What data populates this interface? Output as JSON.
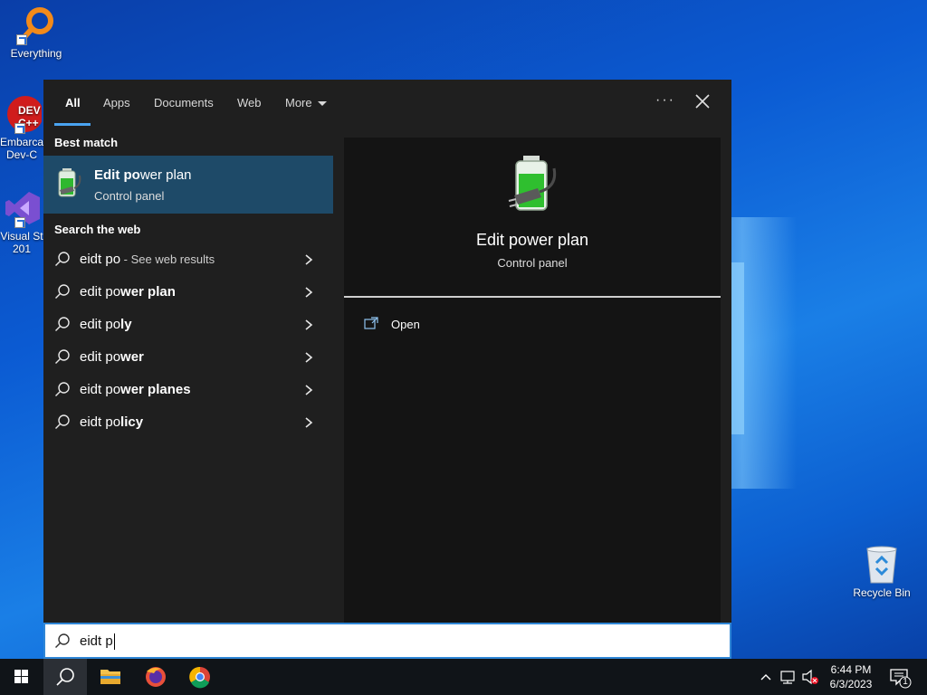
{
  "desktop": {
    "icons": [
      {
        "label": "Everything"
      },
      {
        "label": "Embarca\nDev-C"
      },
      {
        "label": "Visual St\n201"
      },
      {
        "label": "Recycle Bin"
      }
    ]
  },
  "search": {
    "tabs": [
      {
        "label": "All"
      },
      {
        "label": "Apps"
      },
      {
        "label": "Documents"
      },
      {
        "label": "Web"
      },
      {
        "label": "More"
      }
    ],
    "more_options_label": "···",
    "best_match_header": "Best match",
    "best_match": {
      "title_bold": "Edit po",
      "title_rest": "wer plan",
      "subtitle": "Control panel",
      "icon": "battery-power-icon"
    },
    "web_header": "Search the web",
    "suggestions": [
      {
        "normal": "eidt po",
        "bold": "",
        "suffix": " - See web results"
      },
      {
        "normal": "edit po",
        "bold": "wer plan",
        "suffix": ""
      },
      {
        "normal": "edit po",
        "bold": "ly",
        "suffix": ""
      },
      {
        "normal": "edit po",
        "bold": "wer",
        "suffix": ""
      },
      {
        "normal": "eidt po",
        "bold": "wer planes",
        "suffix": ""
      },
      {
        "normal": "eidt po",
        "bold": "licy",
        "suffix": ""
      }
    ],
    "preview": {
      "title": "Edit power plan",
      "subtitle": "Control panel",
      "actions": [
        {
          "label": "Open",
          "icon": "open-icon"
        }
      ]
    },
    "query": "eidt p",
    "accent_color": "#1e4a68"
  },
  "taskbar": {
    "time": "6:44 PM",
    "date": "6/3/2023",
    "notification_count": "1",
    "pinned": [
      "start-icon",
      "search-icon",
      "file-explorer-icon",
      "firefox-icon",
      "chrome-icon"
    ]
  }
}
